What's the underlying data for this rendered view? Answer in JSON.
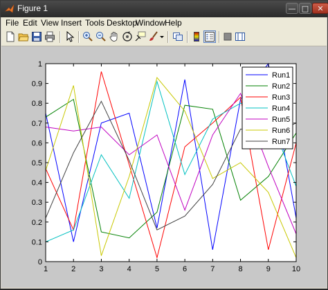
{
  "window": {
    "title": "Figure 1"
  },
  "menu": {
    "items": [
      "File",
      "Edit",
      "View",
      "Insert",
      "Tools",
      "Desktop",
      "Window",
      "Help"
    ]
  },
  "toolbar": {
    "buttons": [
      "new-figure",
      "open-file",
      "save-figure",
      "print-figure",
      "edit-plot",
      "zoom-in",
      "zoom-out",
      "pan",
      "rotate-3d",
      "data-cursor",
      "brush",
      "link-plot",
      "insert-colorbar",
      "insert-legend",
      "hide-plot-tools",
      "show-plot-tools"
    ]
  },
  "chart_data": {
    "type": "line",
    "x": [
      1,
      2,
      3,
      4,
      5,
      6,
      7,
      8,
      9,
      10
    ],
    "xlim": [
      1,
      10
    ],
    "ylim": [
      0,
      1
    ],
    "xticks": [
      "1",
      "2",
      "3",
      "4",
      "5",
      "6",
      "7",
      "8",
      "9",
      "10"
    ],
    "yticks": [
      "0",
      "0.1",
      "0.2",
      "0.3",
      "0.4",
      "0.5",
      "0.6",
      "0.7",
      "0.8",
      "0.9",
      "1"
    ],
    "grid": false,
    "legend_position": "top-right",
    "series": [
      {
        "name": "Run1",
        "color": "#0000ff",
        "values": [
          0.75,
          0.1,
          0.7,
          0.75,
          0.17,
          0.92,
          0.06,
          0.82,
          1.0,
          0.22
        ]
      },
      {
        "name": "Run2",
        "color": "#008000",
        "values": [
          0.73,
          0.82,
          0.15,
          0.12,
          0.25,
          0.79,
          0.77,
          0.31,
          0.43,
          0.65
        ]
      },
      {
        "name": "Run3",
        "color": "#ff0000",
        "values": [
          0.47,
          0.16,
          0.96,
          0.49,
          0.02,
          0.58,
          0.7,
          0.83,
          0.06,
          0.6
        ]
      },
      {
        "name": "Run4",
        "color": "#00c0c0",
        "values": [
          0.1,
          0.16,
          0.54,
          0.32,
          0.91,
          0.44,
          0.72,
          0.8,
          0.75,
          0.38
        ]
      },
      {
        "name": "Run5",
        "color": "#c000c0",
        "values": [
          0.68,
          0.66,
          0.68,
          0.54,
          0.64,
          0.26,
          0.64,
          0.85,
          0.48,
          0.14
        ]
      },
      {
        "name": "Run6",
        "color": "#c8c800",
        "values": [
          0.46,
          0.89,
          0.03,
          0.43,
          0.93,
          0.76,
          0.42,
          0.5,
          0.35,
          0.02
        ]
      },
      {
        "name": "Run7",
        "color": "#404040",
        "values": [
          0.22,
          0.55,
          0.81,
          0.51,
          0.16,
          0.23,
          0.39,
          0.67,
          0.64,
          0.7
        ]
      }
    ]
  }
}
